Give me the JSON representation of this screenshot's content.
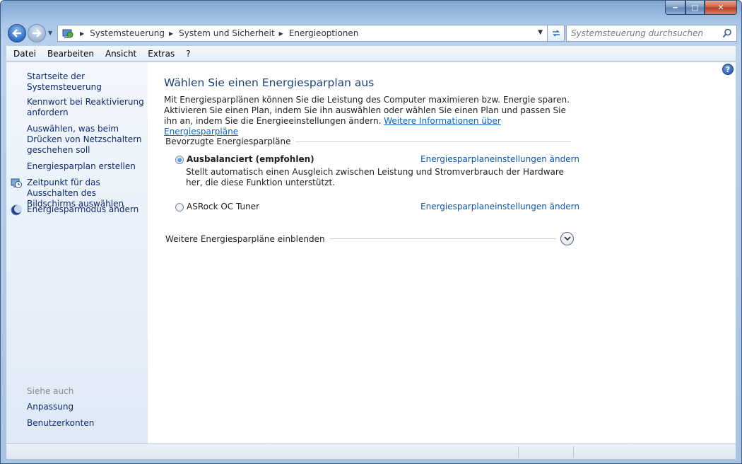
{
  "window": {
    "controls": {
      "minimize": "‒",
      "maximize": "▢",
      "close": "✕"
    }
  },
  "address_bar": {
    "breadcrumbs": [
      "Systemsteuerung",
      "System und Sicherheit",
      "Energieoptionen"
    ]
  },
  "search": {
    "placeholder": "Systemsteuerung durchsuchen"
  },
  "menu": {
    "items": [
      "Datei",
      "Bearbeiten",
      "Ansicht",
      "Extras",
      "?"
    ]
  },
  "sidebar": {
    "links": [
      "Startseite der Systemsteuerung",
      "Kennwort bei Reaktivierung anfordern",
      "Auswählen, was beim Drücken von Netzschaltern geschehen soll",
      "Energiesparplan erstellen",
      "Zeitpunkt für das Ausschalten des Bildschirms auswählen",
      "Energiesparmodus ändern"
    ],
    "see_also_heading": "Siehe auch",
    "see_also": [
      "Anpassung",
      "Benutzerkonten"
    ]
  },
  "main": {
    "title": "Wählen Sie einen Energiesparplan aus",
    "intro": "Mit Energiesparplänen können Sie die Leistung des Computer maximieren bzw. Energie sparen. Aktivieren Sie einen Plan, indem Sie ihn auswählen oder wählen Sie einen Plan und passen Sie ihn an, indem Sie die Energieeinstellungen ändern.",
    "intro_link": "Weitere Informationen über Energiesparpläne",
    "preferred_heading": "Bevorzugte Energiesparpläne",
    "plans": [
      {
        "name": "Ausbalanciert (empfohlen)",
        "selected": true,
        "link": "Energiesparplaneinstellungen ändern",
        "description": "Stellt automatisch einen Ausgleich zwischen Leistung und Stromverbrauch der Hardware her, die diese Funktion unterstützt."
      },
      {
        "name": "ASRock OC Tuner",
        "selected": false,
        "link": "Energiesparplaneinstellungen ändern"
      }
    ],
    "more_plans": "Weitere Energiesparpläne einblenden"
  },
  "icons": {
    "back": "arrow-left-icon",
    "forward": "arrow-right-icon",
    "address": "control-panel-icon",
    "refresh": "refresh-icon",
    "search": "search-icon",
    "help": "help-icon",
    "display_timer": "display-clock-icon",
    "sleep": "moon-icon",
    "expand": "chevron-down-icon"
  },
  "colors": {
    "link": "#0b57b2",
    "title": "#1e3f7a",
    "sidebar_link": "#0d2a6e",
    "frame": "#a9c5e6"
  }
}
